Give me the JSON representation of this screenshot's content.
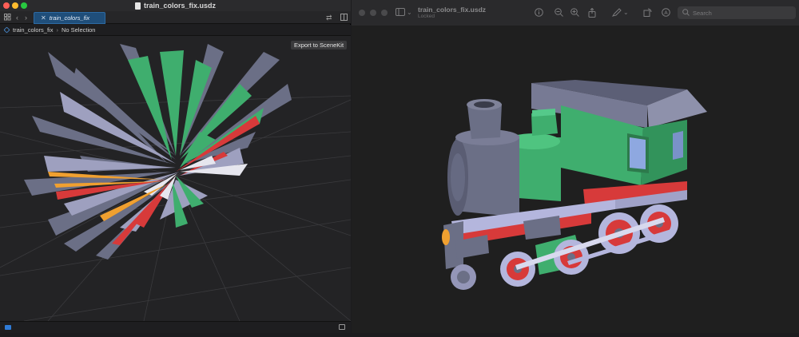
{
  "left_window": {
    "title": "train_colors_fix.usdz",
    "tab_label": "train_colors_fix",
    "breadcrumb": {
      "file": "train_colors_fix",
      "selection": "No Selection"
    },
    "export_button": "Export to SceneKit"
  },
  "right_window": {
    "title": "train_colors_fix.usdz",
    "subtitle": "Locked",
    "search_placeholder": "Search"
  },
  "colors": {
    "close": "#ff5f57",
    "minimize": "#febc2e",
    "zoom": "#28c840",
    "accent": "#2f7bd6",
    "train_green": "#3fae6e",
    "train_gray": "#6e7187",
    "train_red": "#d73a3a",
    "train_lavender": "#b4b6dd"
  },
  "icons": [
    "document-icon",
    "sidebar-grid-icon",
    "back-icon",
    "forward-icon",
    "swap-icon",
    "split-icon",
    "cube-icon",
    "chevron-icon",
    "sidebar-icon",
    "info-icon",
    "zoom-out-icon",
    "zoom-in-icon",
    "share-icon",
    "markup-icon",
    "rotate-icon",
    "annotate-icon",
    "search-icon"
  ]
}
